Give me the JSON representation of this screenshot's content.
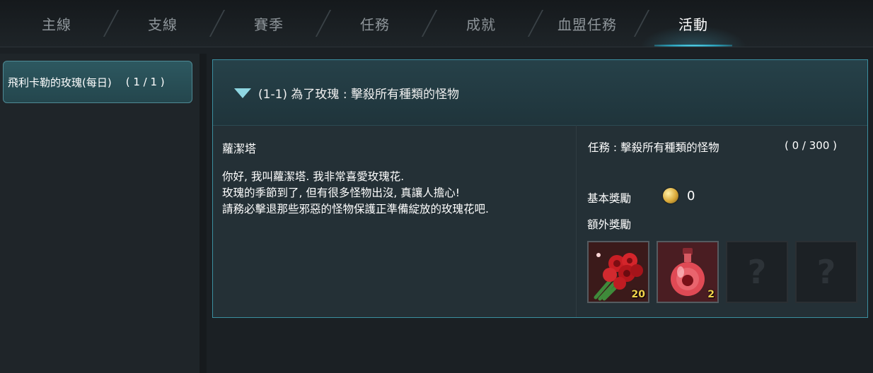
{
  "tabs": [
    {
      "label": "主線",
      "active": false
    },
    {
      "label": "支線",
      "active": false
    },
    {
      "label": "賽季",
      "active": false
    },
    {
      "label": "任務",
      "active": false
    },
    {
      "label": "成就",
      "active": false
    },
    {
      "label": "血盟任務",
      "active": false
    },
    {
      "label": "活動",
      "active": true
    }
  ],
  "sidebar": {
    "items": [
      {
        "label": "飛利卡勒的玫瑰(每日)",
        "count": "( 1 / 1 )",
        "selected": true
      }
    ]
  },
  "quest": {
    "title": "(1-1) 為了玫瑰 : 擊殺所有種類的怪物",
    "npc_name": "蘿潔塔",
    "dialog": [
      "你好, 我叫蘿潔塔. 我非常喜愛玫瑰花.",
      "玫瑰的季節到了, 但有很多怪物出沒, 真讓人擔心!",
      "請務必擊退那些邪惡的怪物保護正準備綻放的玫瑰花吧."
    ],
    "objective": "任務 : 擊殺所有種類的怪物",
    "progress": "( 0 / 300 )",
    "base_reward_label": "基本獎勵",
    "base_reward_value": "0",
    "extra_reward_label": "額外獎勵",
    "rewards": [
      {
        "icon": "rose-bouquet-icon",
        "quantity": "20"
      },
      {
        "icon": "rose-potion-icon",
        "quantity": "2"
      },
      {
        "icon": "locked-mystery-icon",
        "quantity": ""
      },
      {
        "icon": "locked-mystery-icon",
        "quantity": ""
      }
    ]
  },
  "colors": {
    "accent": "#3b8fa0",
    "active_tab_glow": "#6fe2f5",
    "quantity": "#f2d34b"
  }
}
